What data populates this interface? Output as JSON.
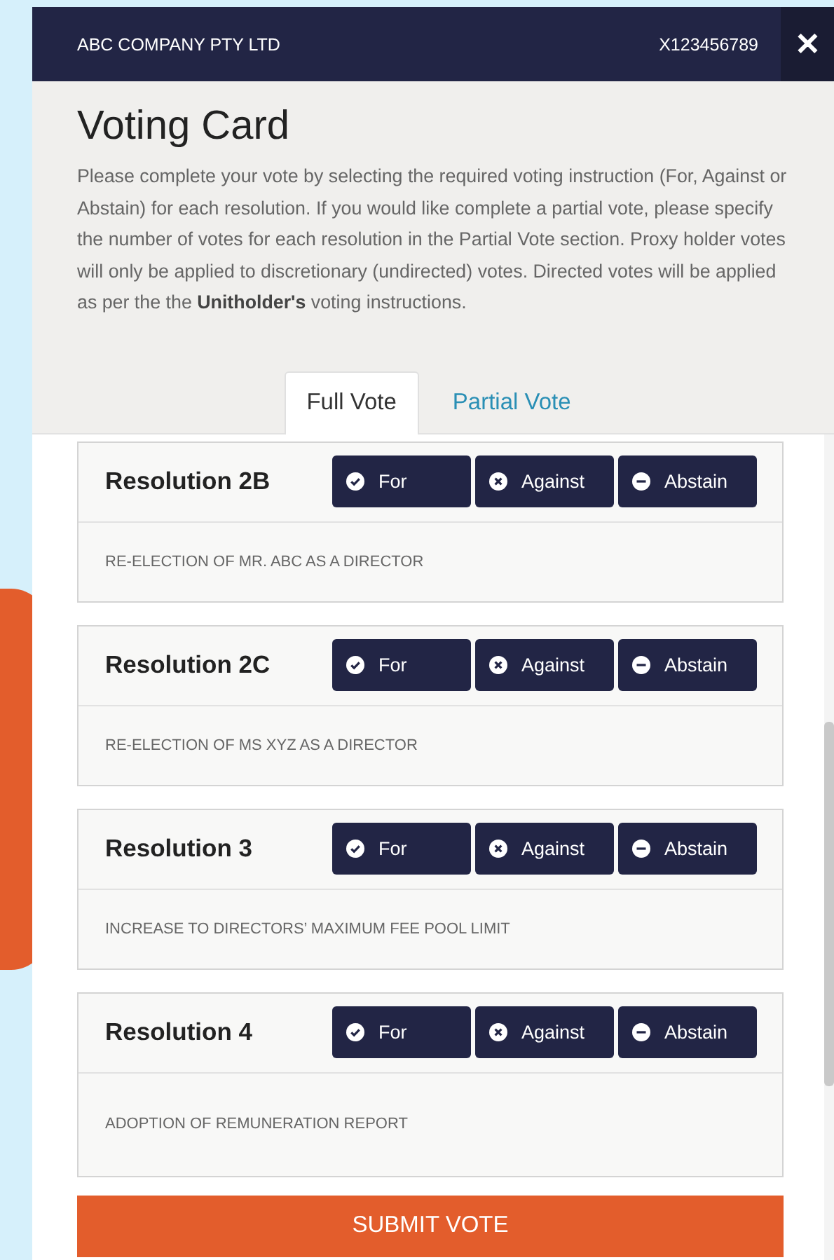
{
  "header": {
    "company": "ABC COMPANY PTY LTD",
    "account": "X123456789",
    "close": "✕"
  },
  "title": "Voting Card",
  "instructions": "Please complete your vote by selecting the required voting instruction (For, Against or Abstain) for each resolution. If you would like complete a partial vote, please specify the number of votes for each resolution in the Partial Vote section. Proxy holder votes will only be applied to discretionary (undirected) votes. Directed votes will be applied as per the the **Unitholder's** voting instructions.",
  "tabs": [
    {
      "label": "Full Vote",
      "selected": true
    },
    {
      "label": "Partial Vote",
      "selected": false
    }
  ],
  "resolutions": [
    {
      "name": "Resolution 2B",
      "description": "RE-ELECTION OF MR. ABC AS A DIRECTOR",
      "options": [
        {
          "kind": "for",
          "label": "For"
        },
        {
          "kind": "against",
          "label": "Against"
        },
        {
          "kind": "abstain",
          "label": "Abstain"
        }
      ]
    },
    {
      "name": "Resolution 2C",
      "description": "RE-ELECTION OF MS XYZ AS A DIRECTOR",
      "options": [
        {
          "kind": "for",
          "label": "For"
        },
        {
          "kind": "against",
          "label": "Against"
        },
        {
          "kind": "abstain",
          "label": "Abstain"
        }
      ]
    },
    {
      "name": "Resolution 3",
      "description": "INCREASE TO DIRECTORS’ MAXIMUM FEE POOL LIMIT",
      "options": [
        {
          "kind": "for",
          "label": "For"
        },
        {
          "kind": "against",
          "label": "Against"
        },
        {
          "kind": "abstain",
          "label": "Abstain"
        }
      ]
    },
    {
      "name": "Resolution 4",
      "description": "ADOPTION OF REMUNERATION REPORT",
      "options": [
        {
          "kind": "for",
          "label": "For"
        },
        {
          "kind": "against",
          "label": "Against"
        },
        {
          "kind": "abstain",
          "label": "Abstain"
        }
      ]
    }
  ],
  "submit": "SUBMIT VOTE"
}
